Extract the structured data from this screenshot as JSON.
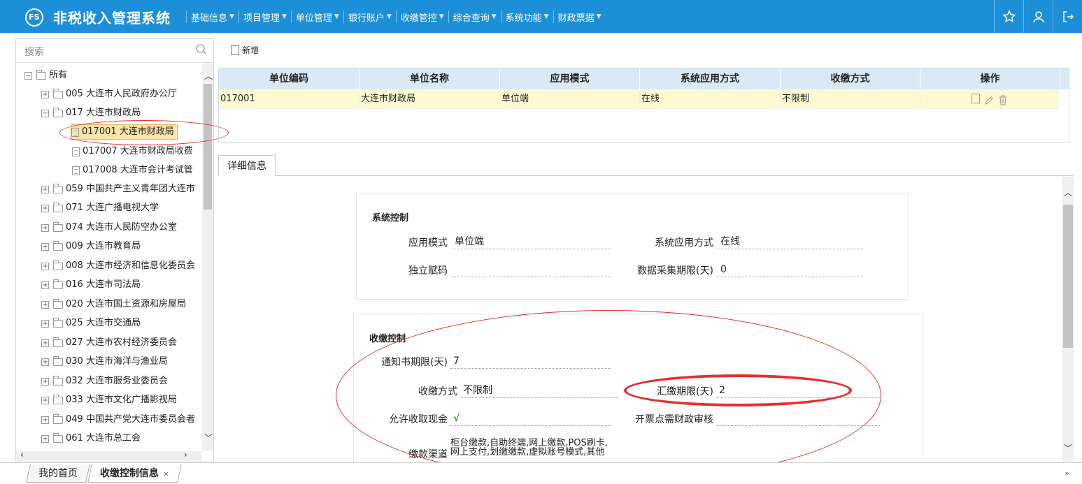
{
  "app": {
    "logo": "FS",
    "title": "非税收入管理系统"
  },
  "nav": [
    {
      "label": "基础信息"
    },
    {
      "label": "项目管理"
    },
    {
      "label": "单位管理"
    },
    {
      "label": "银行账户"
    },
    {
      "label": "收缴管控"
    },
    {
      "label": "综合查询"
    },
    {
      "label": "系统功能"
    },
    {
      "label": "财政票据"
    }
  ],
  "top_icons": [
    "star-icon",
    "user-icon",
    "logout-icon"
  ],
  "search": {
    "placeholder": "搜索"
  },
  "tree": {
    "root": "所有",
    "nodes": [
      {
        "label": "005 大连市人民政府办公厅"
      },
      {
        "label": "017 大连市财政局"
      },
      {
        "label": "017001 大连市财政局"
      },
      {
        "label": "017007 大连市财政局收费"
      },
      {
        "label": "017008 大连市会计考试管"
      },
      {
        "label": "059 中国共产主义青年团大连市"
      },
      {
        "label": "071 大连广播电视大学"
      },
      {
        "label": "074 大连市人民防空办公室"
      },
      {
        "label": "009 大连市教育局"
      },
      {
        "label": "008 大连市经济和信息化委员会"
      },
      {
        "label": "016 大连市司法局"
      },
      {
        "label": "020 大连市国土资源和房屋局"
      },
      {
        "label": "025 大连市交通局"
      },
      {
        "label": "027 大连市农村经济委员会"
      },
      {
        "label": "030 大连市海洋与渔业局"
      },
      {
        "label": "032 大连市服务业委员会"
      },
      {
        "label": "033 大连市文化广播影视局"
      },
      {
        "label": "049 中国共产党大连市委员会者"
      },
      {
        "label": "061 大连市总工会"
      }
    ]
  },
  "toolbar": {
    "add_label": "新增"
  },
  "grid": {
    "headers": [
      "单位编码",
      "单位名称",
      "应用模式",
      "系统应用方式",
      "收缴方式",
      "操作"
    ],
    "row": {
      "code": "017001",
      "name": "大连市财政局",
      "mode": "单位端",
      "apply": "在线",
      "pay": "不限制"
    }
  },
  "detail_tab": "详细信息",
  "system_control": {
    "title": "系统控制",
    "app_mode_label": "应用模式",
    "app_mode_value": "单位端",
    "sys_apply_label": "系统应用方式",
    "sys_apply_value": "在线",
    "independent_label": "独立赋码",
    "independent_value": "",
    "collect_label": "数据采集期限(天)",
    "collect_value": "0"
  },
  "payment_control": {
    "title": "收缴控制",
    "notice_label": "通知书期限(天)",
    "notice_value": "7",
    "method_label": "收缴方式",
    "method_value": "不限制",
    "remit_label": "汇缴期限(天)",
    "remit_value": "2",
    "cash_label": "允许收取现金",
    "cash_value": "√",
    "audit_label": "开票点需财政审核",
    "audit_value": "",
    "channel_label": "缴款渠道",
    "channel_value": "柜台缴款,自助终端,网上缴款,POS刷卡,网上支付,划缴缴款,虚拟账号模式,其他"
  },
  "bottom_tabs": {
    "home": "我的首页",
    "active": "收缴控制信息",
    "close": "×"
  },
  "bottom_right": "»"
}
